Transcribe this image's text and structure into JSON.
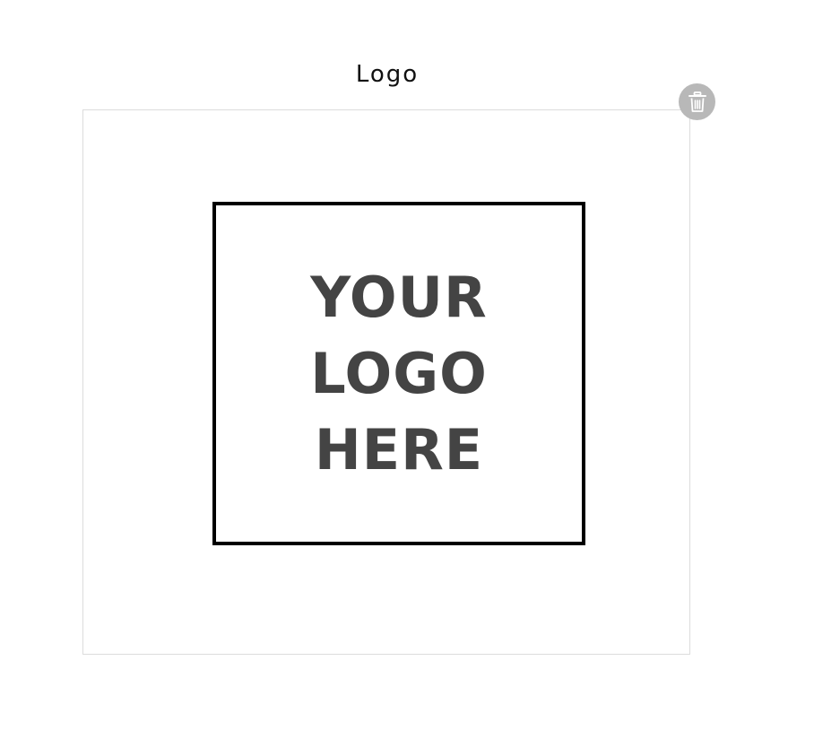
{
  "section": {
    "title": "Logo"
  },
  "logo_placeholder": {
    "lines": [
      "YOUR",
      "LOGO",
      "HERE"
    ]
  },
  "delete_button": {
    "icon": "trash-icon",
    "color": "#b8b8b8"
  }
}
